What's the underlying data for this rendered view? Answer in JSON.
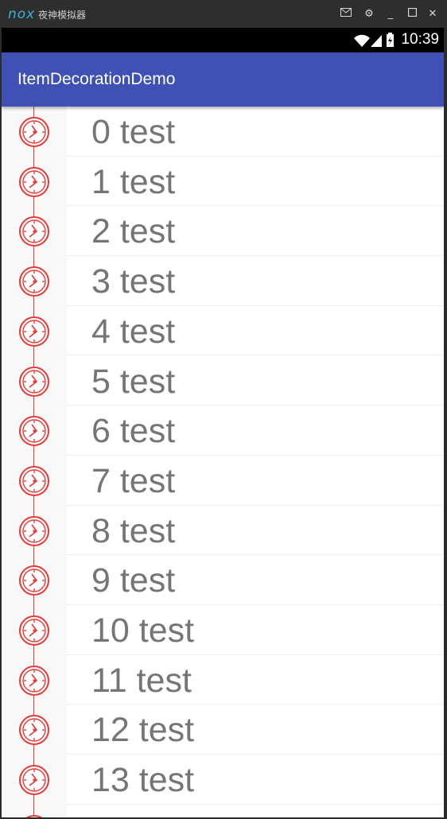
{
  "window": {
    "logo": "nox",
    "title": "夜神模拟器",
    "buttons": [
      "mail-icon",
      "settings-icon",
      "minimize-icon",
      "maximize-icon",
      "close-icon"
    ]
  },
  "status_bar": {
    "time": "10:39",
    "icons": [
      "wifi-icon",
      "signal-icon",
      "battery-icon"
    ]
  },
  "app_bar": {
    "title": "ItemDecorationDemo",
    "color": "#3f51b5"
  },
  "list": {
    "marker_color": "#e53935",
    "marker_icon": "clock-icon",
    "items": [
      {
        "label": "0 test"
      },
      {
        "label": "1 test"
      },
      {
        "label": "2 test"
      },
      {
        "label": "3 test"
      },
      {
        "label": "4 test"
      },
      {
        "label": "5 test"
      },
      {
        "label": "6 test"
      },
      {
        "label": "7 test"
      },
      {
        "label": "8 test"
      },
      {
        "label": "9 test"
      },
      {
        "label": "10 test"
      },
      {
        "label": "11 test"
      },
      {
        "label": "12 test"
      },
      {
        "label": "13 test"
      }
    ]
  }
}
